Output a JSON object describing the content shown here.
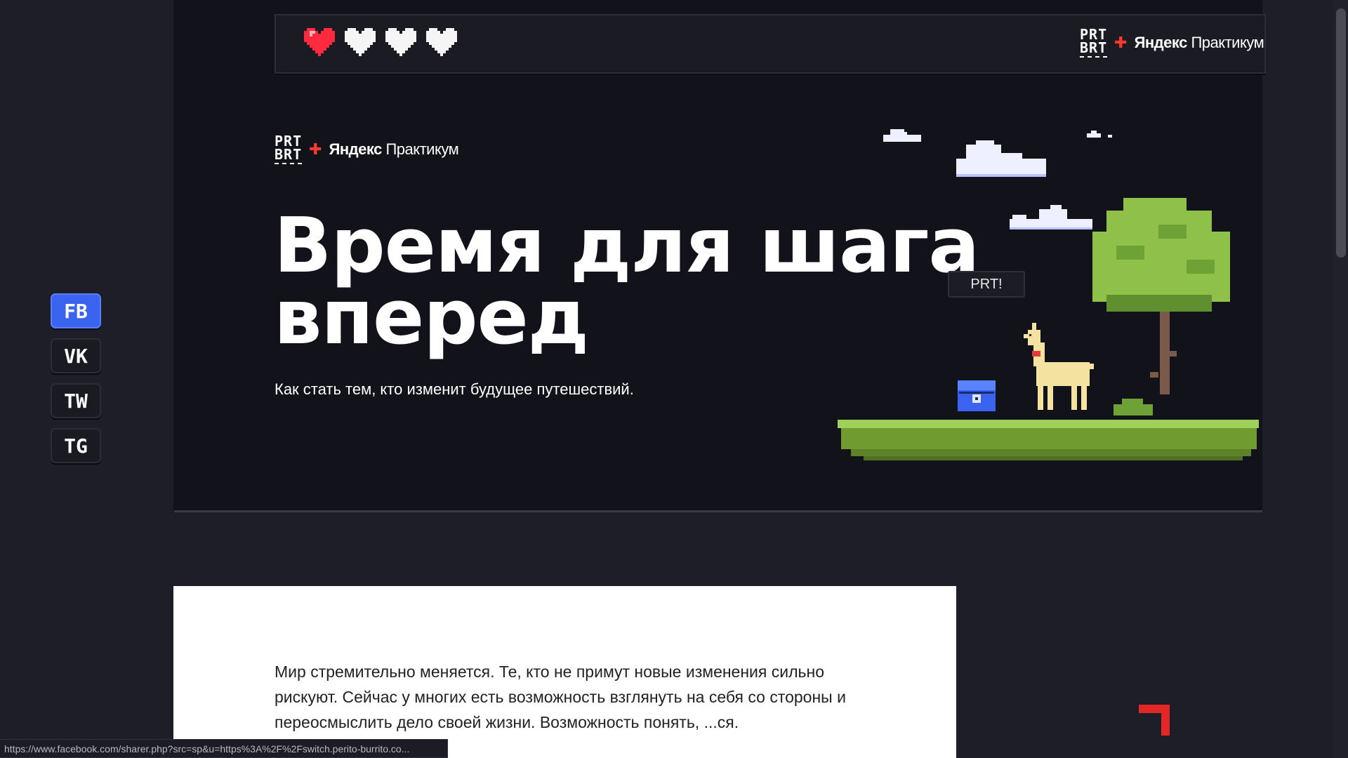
{
  "header": {
    "hearts_total": 4,
    "hearts_filled": 1,
    "brand_prt": [
      "PRT",
      "BRT"
    ],
    "brand_yandex": "Яндекс",
    "brand_practicum": "Практикум"
  },
  "hero": {
    "title_line1": "Время для шага",
    "title_line2": "вперед",
    "subtitle": "Как стать тем, кто изменит будущее путешествий.",
    "bubble": "PRT!"
  },
  "social": [
    {
      "label": "FB",
      "active": true
    },
    {
      "label": "VK",
      "active": false
    },
    {
      "label": "TW",
      "active": false
    },
    {
      "label": "TG",
      "active": false
    }
  ],
  "article": {
    "text": "Мир стремительно меняется. Те, кто не примут новые изменения сильно рискуют. Сейчас у многих есть возможность взглянуть на себя со стороны и переосмыслить дело своей жизни. Возможность понять, ...ся."
  },
  "status_url": "https://www.facebook.com/sharer.php?src=sp&u=https%3A%2F%2Fswitch.perito-burrito.co...",
  "colors": {
    "accent_blue": "#3a63f0",
    "heart_red": "#ff2a3d",
    "brand_red": "#ff3b30",
    "corner_red": "#e32626"
  }
}
